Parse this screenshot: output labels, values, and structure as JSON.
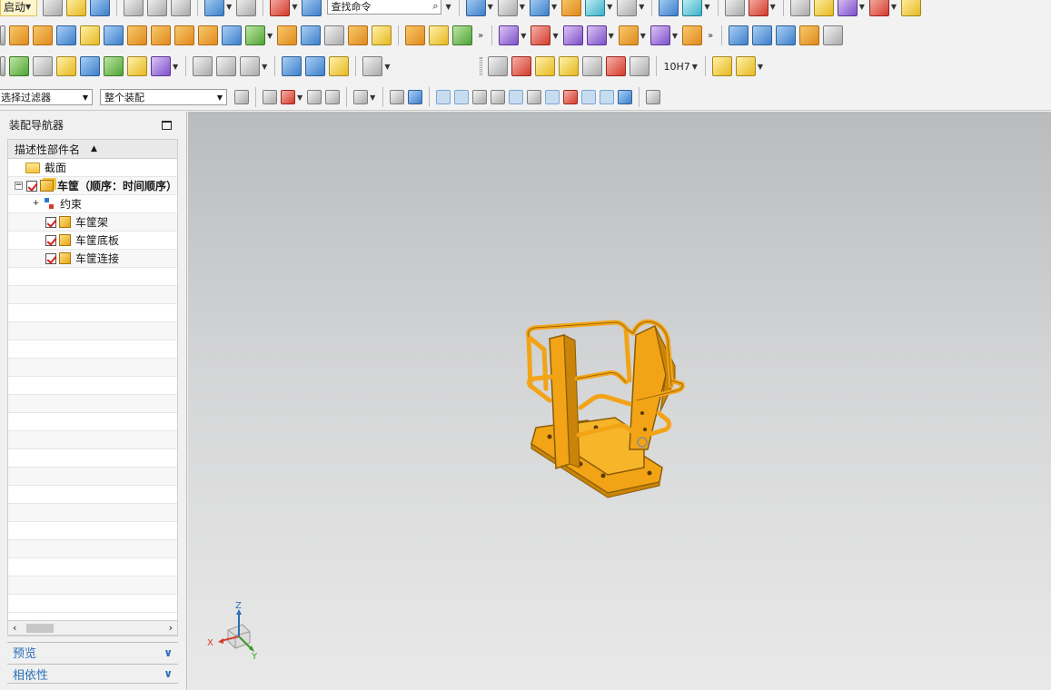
{
  "toolbar": {
    "start_label": "启动",
    "search_placeholder": "查找命令",
    "filter_select": "选择过滤器",
    "scope_select": "整个装配",
    "tolerance_label": "10H7"
  },
  "navigator": {
    "title": "装配导航器",
    "column_header": "描述性部件名",
    "rows": [
      {
        "label": "截面"
      },
      {
        "label": "车筐（顺序：时间顺序）"
      },
      {
        "label": "约束"
      },
      {
        "label": "车筐架"
      },
      {
        "label": "车筐底板"
      },
      {
        "label": "车筐连接"
      }
    ],
    "preview_label": "预览",
    "dependency_label": "相依性"
  },
  "triad": {
    "x_label": "X",
    "y_label": "Y",
    "z_label": "Z"
  },
  "colors": {
    "model": "#f2a416",
    "model_edge": "#8a5c06",
    "link": "#2a6fb8"
  }
}
